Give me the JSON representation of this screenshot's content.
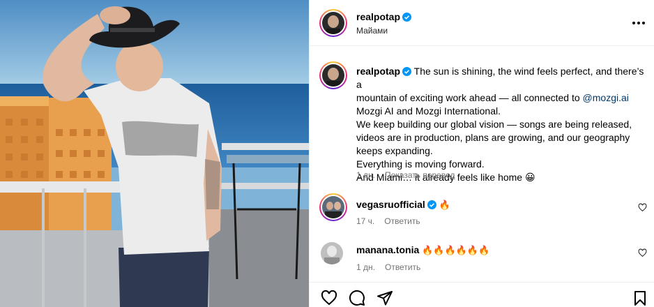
{
  "post": {
    "author": "realpotap",
    "verified": true,
    "location": "Майами",
    "caption_lines": [
      "The sun is shining, the wind feels perfect, and there’s a",
      "mountain of exciting work ahead — all connected to ",
      "Mozgi AI and Mozgi International.",
      "We keep building our global vision — songs are being released,",
      "videos are in production, plans are growing, and our geography",
      "keeps expanding.",
      "Everything is moving forward.",
      "And Miami… it already feels like home "
    ],
    "mention": "@mozgi.ai",
    "caption_emoji": "😀",
    "time": "1 дн.",
    "translate_label": "Показать перевод"
  },
  "comments": [
    {
      "username": "vegasruofficial",
      "verified": true,
      "text": "🔥",
      "time": "17 ч.",
      "reply_label": "Ответить"
    },
    {
      "username": "manana.tonia",
      "verified": false,
      "text": "🔥🔥🔥🔥🔥🔥",
      "time": "1 дн.",
      "reply_label": "Ответить"
    }
  ],
  "icons": {
    "more": "more-options-icon",
    "like": "heart-icon",
    "comment": "comment-icon",
    "share": "share-icon",
    "save": "bookmark-icon",
    "verified": "verified-badge-icon"
  },
  "colors": {
    "verified": "#0095f6",
    "mention": "#00376b",
    "secondary": "#737373",
    "fire": "#ff5a1f"
  }
}
